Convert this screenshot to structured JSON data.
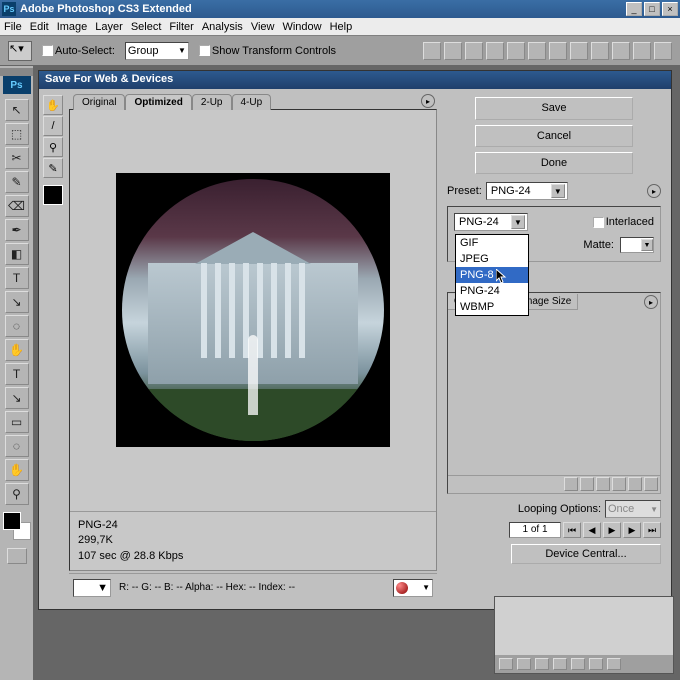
{
  "titlebar": {
    "app": "Adobe Photoshop CS3 Extended",
    "badge": "Ps"
  },
  "menubar": [
    "File",
    "Edit",
    "Image",
    "Layer",
    "Select",
    "Filter",
    "Analysis",
    "View",
    "Window",
    "Help"
  ],
  "options": {
    "auto_select": "Auto-Select:",
    "group": "Group",
    "show_transform": "Show Transform Controls"
  },
  "toolbox": {
    "badge": "Ps",
    "tools_left": [
      "↖",
      "⬚",
      "✂",
      "✎",
      "⌫",
      "✒",
      "◧",
      "T",
      "↘",
      "◌",
      "✋",
      "⚲"
    ],
    "tools_right": [
      "✛",
      "✎",
      "◐",
      "/",
      "●",
      "▭",
      "◧",
      "◌",
      "✋",
      "⚲"
    ]
  },
  "dialog": {
    "title": "Save For Web & Devices",
    "tabs": [
      "Original",
      "Optimized",
      "2-Up",
      "4-Up"
    ],
    "mini_tools": [
      "✋",
      "/",
      "⚲",
      "✎"
    ],
    "info": {
      "format": "PNG-24",
      "size": "299,7K",
      "time": "107 sec @ 28.8 Kbps"
    },
    "bottom_info": "R:   --   G:   --   B:   --    Alpha:   --    Hex:   --      Index:   --",
    "buttons": {
      "save": "Save",
      "cancel": "Cancel",
      "done": "Done",
      "device": "Device Central..."
    },
    "preset_label": "Preset:",
    "preset_value": "PNG-24",
    "format_value": "PNG-24",
    "dropdown": [
      "GIF",
      "JPEG",
      "PNG-8",
      "PNG-24",
      "WBMP"
    ],
    "dropdown_selected": "PNG-8",
    "interlaced": "Interlaced",
    "matte": "Matte:",
    "color_table": "Color Table",
    "image_size": "Image Size",
    "looping": "Looping Options:",
    "loop_value": "Once",
    "anim_count": "1 of 1"
  }
}
